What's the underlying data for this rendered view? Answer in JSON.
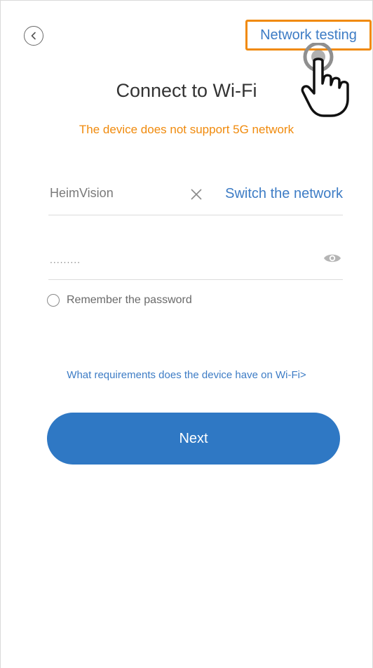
{
  "header": {
    "network_testing_label": "Network testing"
  },
  "main": {
    "title": "Connect to Wi-Fi",
    "warning": "The device does not support 5G network",
    "ssid": {
      "value": "HeimVision",
      "switch_label": "Switch the network"
    },
    "password": {
      "value": "........."
    },
    "remember_label": "Remember the password",
    "requirements_link": "What requirements does the device have on Wi-Fi>",
    "next_label": "Next"
  },
  "colors": {
    "accent": "#2f78c4",
    "link": "#3d7cc5",
    "warning": "#f08a0c",
    "highlight_box": "#f08a0c"
  },
  "icons": {
    "back": "chevron-left-icon",
    "clear": "close-icon",
    "toggle_password": "eye-icon",
    "pointer": "hand-pointer-icon"
  }
}
